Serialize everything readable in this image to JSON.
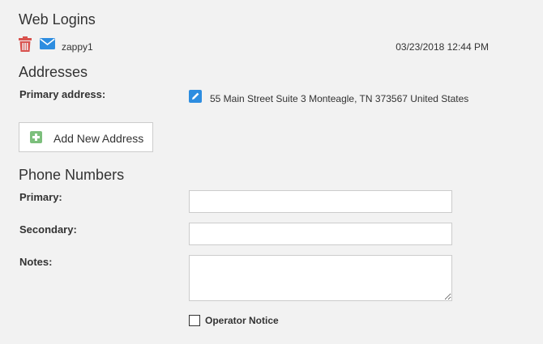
{
  "web_logins": {
    "title": "Web Logins",
    "entries": [
      {
        "username": "zappy1",
        "timestamp": "03/23/2018 12:44 PM",
        "delete_icon": "trash-icon",
        "email_icon": "envelope-icon",
        "delete_color": "#d9534f",
        "email_color": "#2d8de0"
      }
    ]
  },
  "addresses": {
    "title": "Addresses",
    "primary_label": "Primary address:",
    "primary_value": "55 Main Street Suite 3 Monteagle, TN 373567 United States",
    "edit_icon": "pencil-icon",
    "add_button_label": "Add New Address",
    "add_icon": "plus-icon"
  },
  "phone_numbers": {
    "title": "Phone Numbers",
    "primary_label": "Primary:",
    "primary_value": "",
    "secondary_label": "Secondary:",
    "secondary_value": "",
    "notes_label": "Notes:",
    "notes_value": "",
    "operator_notice_label": "Operator Notice",
    "operator_notice_checked": false
  }
}
